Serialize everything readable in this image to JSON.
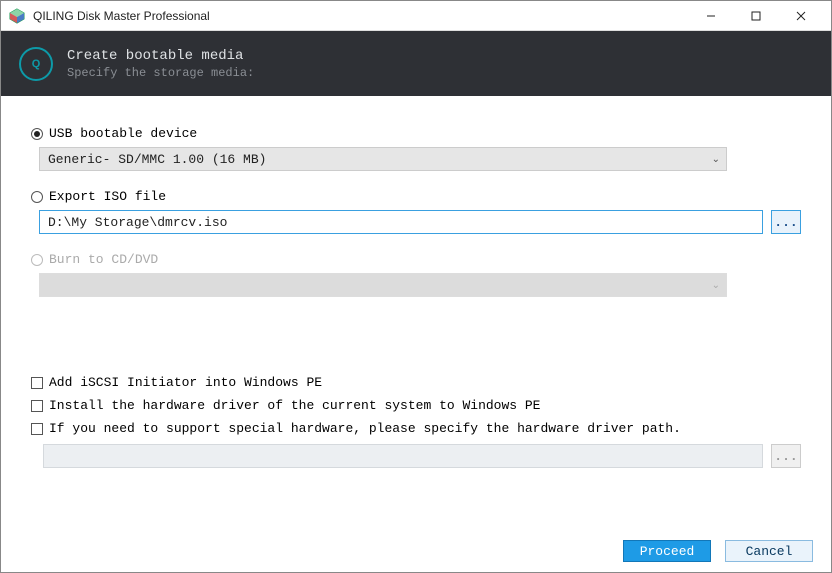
{
  "window": {
    "title": "QILING Disk Master Professional"
  },
  "header": {
    "title": "Create bootable media",
    "subtitle": "Specify the storage media:"
  },
  "options": {
    "usb": {
      "label": "USB bootable device",
      "dropdown_value": "Generic- SD/MMC 1.00 (16 MB)"
    },
    "iso": {
      "label": "Export ISO file",
      "path": "D:\\My Storage\\dmrcv.iso",
      "browse": "..."
    },
    "cddvd": {
      "label": "Burn to CD/DVD"
    }
  },
  "checks": {
    "iscsi": "Add iSCSI Initiator into Windows PE",
    "hwdriver": "Install the hardware driver of the current system to Windows PE",
    "specialhw": "If you need to support special hardware, please specify the hardware driver path.",
    "browse": "..."
  },
  "footer": {
    "proceed": "Proceed",
    "cancel": "Cancel"
  }
}
